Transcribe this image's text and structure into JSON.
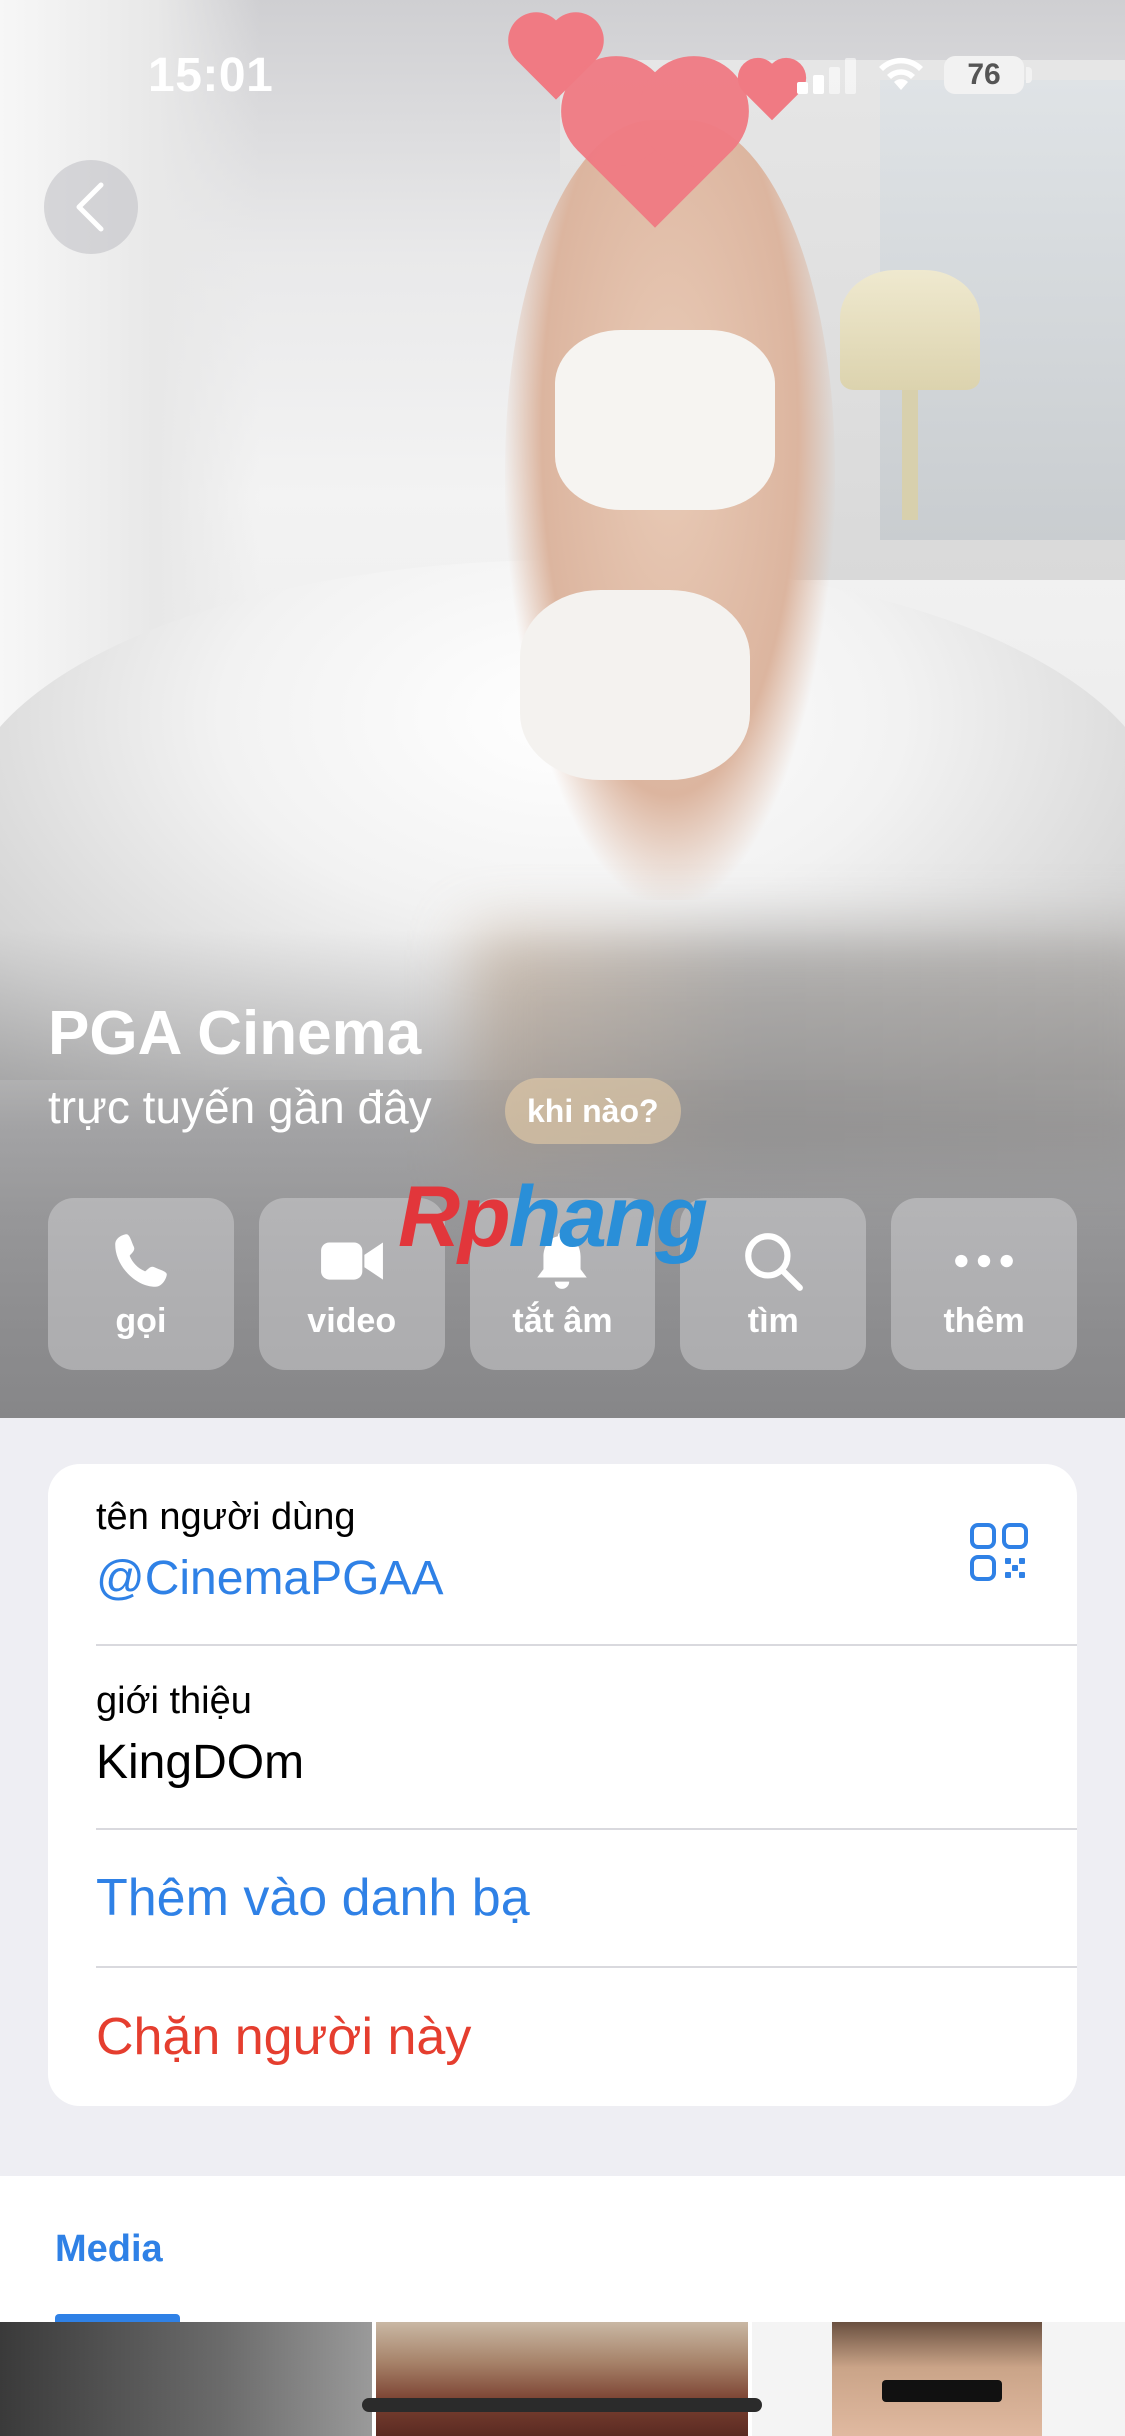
{
  "status_bar": {
    "time": "15:01",
    "battery_level": "76",
    "icons": [
      "cellular-signal-icon",
      "wifi-icon",
      "battery-icon"
    ]
  },
  "header": {
    "back_icon": "chevron-left-icon",
    "name": "PGA Cinema",
    "status": "trực tuyến gần đây",
    "when_chip": "khi nào?",
    "watermark_left": "Rp",
    "watermark_right": "hang"
  },
  "actions": [
    {
      "label": "gọi",
      "icon": "phone-icon"
    },
    {
      "label": "video",
      "icon": "video-camera-icon"
    },
    {
      "label": "tắt âm",
      "icon": "bell-icon"
    },
    {
      "label": "tìm",
      "icon": "search-icon"
    },
    {
      "label": "thêm",
      "icon": "more-dots-icon"
    }
  ],
  "info": {
    "username_label": "tên người dùng",
    "username": "@CinemaPGAA",
    "bio_label": "giới thiệu",
    "bio": "KingDOm",
    "add_contact": "Thêm vào danh bạ",
    "block_user": "Chặn người này"
  },
  "media": {
    "tab_label": "Media"
  },
  "colors": {
    "accent": "#2f81e6",
    "danger": "#e53e2f",
    "background": "#eeeef3"
  }
}
